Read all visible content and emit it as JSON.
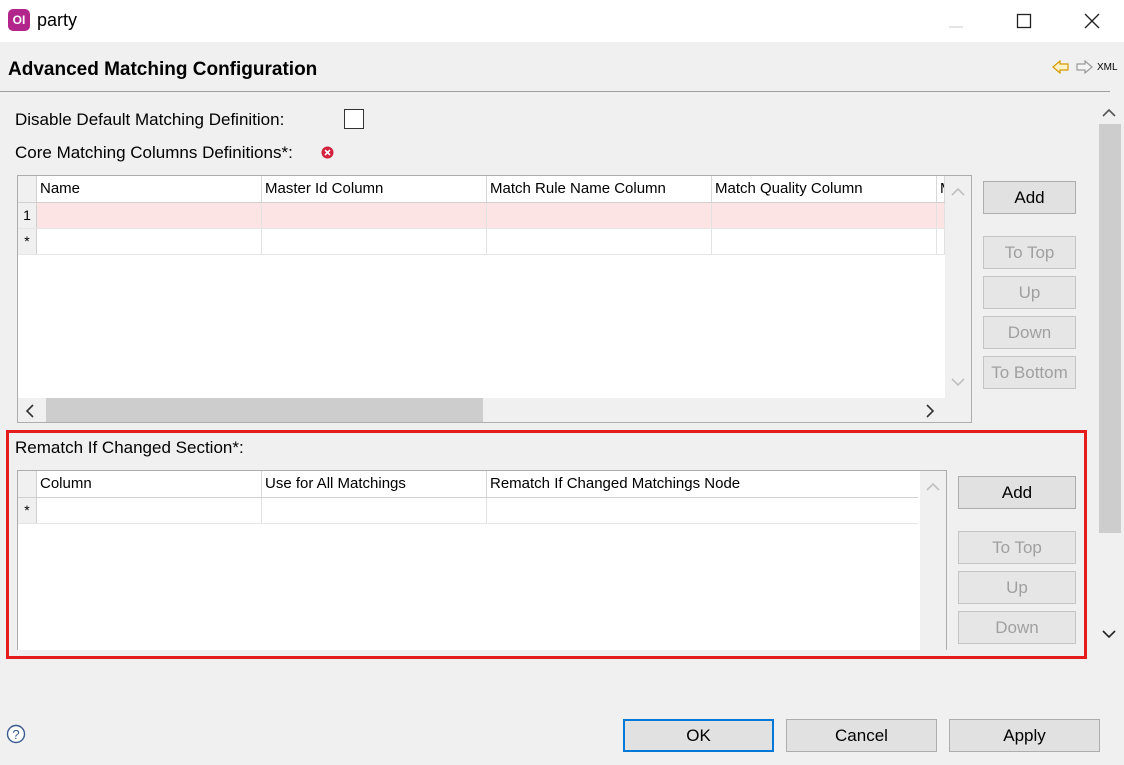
{
  "window": {
    "app_icon_text": "OI",
    "title": "party"
  },
  "header": {
    "title": "Advanced Matching Configuration",
    "xml_label": "XML"
  },
  "disable_default": {
    "label": "Disable Default Matching Definition:",
    "checked": false
  },
  "core": {
    "label": "Core Matching Columns Definitions*:",
    "columns": [
      "Name",
      "Master Id Column",
      "Match Rule Name Column",
      "Match Quality Column",
      "M"
    ],
    "rows": [
      {
        "header": "1"
      },
      {
        "header": "*"
      }
    ],
    "buttons": {
      "add": "Add",
      "to_top": "To Top",
      "up": "Up",
      "down": "Down",
      "to_bottom": "To Bottom"
    }
  },
  "rematch": {
    "label": "Rematch If Changed Section*:",
    "columns": [
      "Column",
      "Use for All Matchings",
      "Rematch If Changed Matchings Node"
    ],
    "rows": [
      {
        "header": "*"
      }
    ],
    "buttons": {
      "add": "Add",
      "to_top": "To Top",
      "up": "Up",
      "down": "Down"
    }
  },
  "footer": {
    "ok": "OK",
    "cancel": "Cancel",
    "apply": "Apply"
  },
  "colors": {
    "error_row": "#fde4e4",
    "highlight": "#e41c1c",
    "app_icon": "#b2268c",
    "default_button": "#0078d7"
  }
}
